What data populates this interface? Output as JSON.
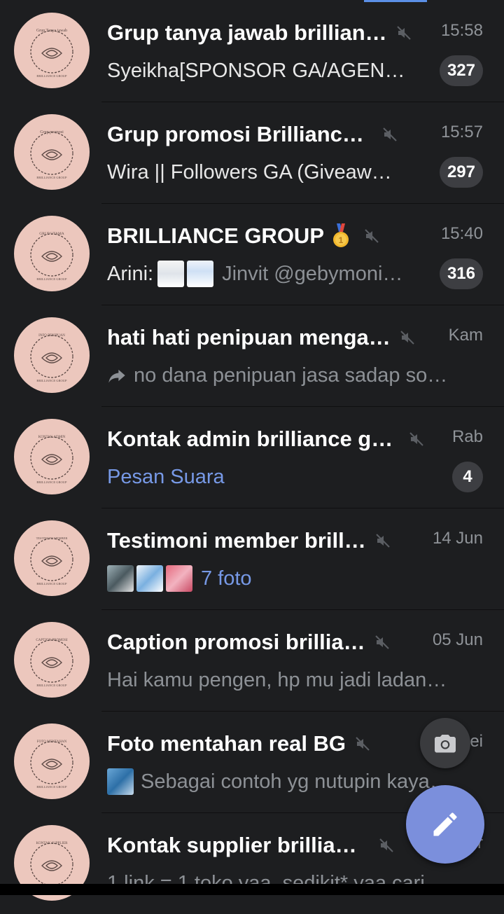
{
  "chats": [
    {
      "avatar_text": "Grup Tanya jawab",
      "avatar_sub": "BRILLIANCE GROUP",
      "title": "Grup tanya jawab brillian…",
      "time": "15:58",
      "preview": "Syeikha[SPONSOR GA/AGEN…",
      "badge": "327"
    },
    {
      "avatar_text": "Grup promosi",
      "avatar_sub": "BRILLIANCE GROUP",
      "title": "Grup promosi Brilliance…",
      "time": "15:57",
      "preview": "Wira || Followers GA (Giveaw…",
      "badge": "297"
    },
    {
      "avatar_text": "GRUP UTAMA",
      "avatar_sub": "BRILLIANCE GROUP",
      "title": "BRILLIANCE GROUP",
      "time": "15:40",
      "sender": "Arini:",
      "preview": "Jinvit @gebymoni…",
      "badge": "316"
    },
    {
      "avatar_text": "INFO PENIPUAN",
      "avatar_sub": "BRILLIANCE GROUP",
      "title": "hati hati penipuan menga…",
      "time": "Kam",
      "preview": "no dana penipuan jasa sadap so…"
    },
    {
      "avatar_text": "KONTAK ADMIN",
      "avatar_sub": "BRILLIANCE GROUP",
      "title": "Kontak admin brilliance gr…",
      "time": "Rab",
      "preview": "Pesan Suara",
      "badge": "4"
    },
    {
      "avatar_text": "TESTIMONI MEMBER",
      "avatar_sub": "BRILLIANCE GROUP",
      "title": "Testimoni member brill…",
      "time": "14 Jun",
      "preview": "7 foto"
    },
    {
      "avatar_text": "CAPTION PROMOSI",
      "avatar_sub": "BRILLIANCE GROUP",
      "title": "Caption promosi brillia…",
      "time": "05 Jun",
      "preview": "Hai kamu pengen, hp mu jadi ladan…"
    },
    {
      "avatar_text": "FOTO MENTAHAN",
      "avatar_sub": "BRILLIANCE GROUP",
      "title": "Foto mentahan real BG",
      "time": "ei",
      "preview": "Sebagai contoh yg nutupin kaya…"
    },
    {
      "avatar_text": "KONTAK SUPPLIER",
      "avatar_sub": "BRILLIANCE GROUP",
      "title": "Kontak supplier brillian…",
      "time": "r",
      "preview": "1 link = 1 toko yaa, sedikit* yaa cari…"
    }
  ],
  "icons": {
    "mute": "muted-speaker-icon",
    "medal": "medal-icon",
    "forward": "forward-arrow-icon",
    "camera": "camera-icon",
    "pencil": "pencil-icon"
  },
  "colors": {
    "background": "#1d1e20",
    "accent": "#7b8fdc",
    "link": "#7799e6",
    "avatar": "#ecc7bd",
    "badge": "#3d3e42"
  }
}
